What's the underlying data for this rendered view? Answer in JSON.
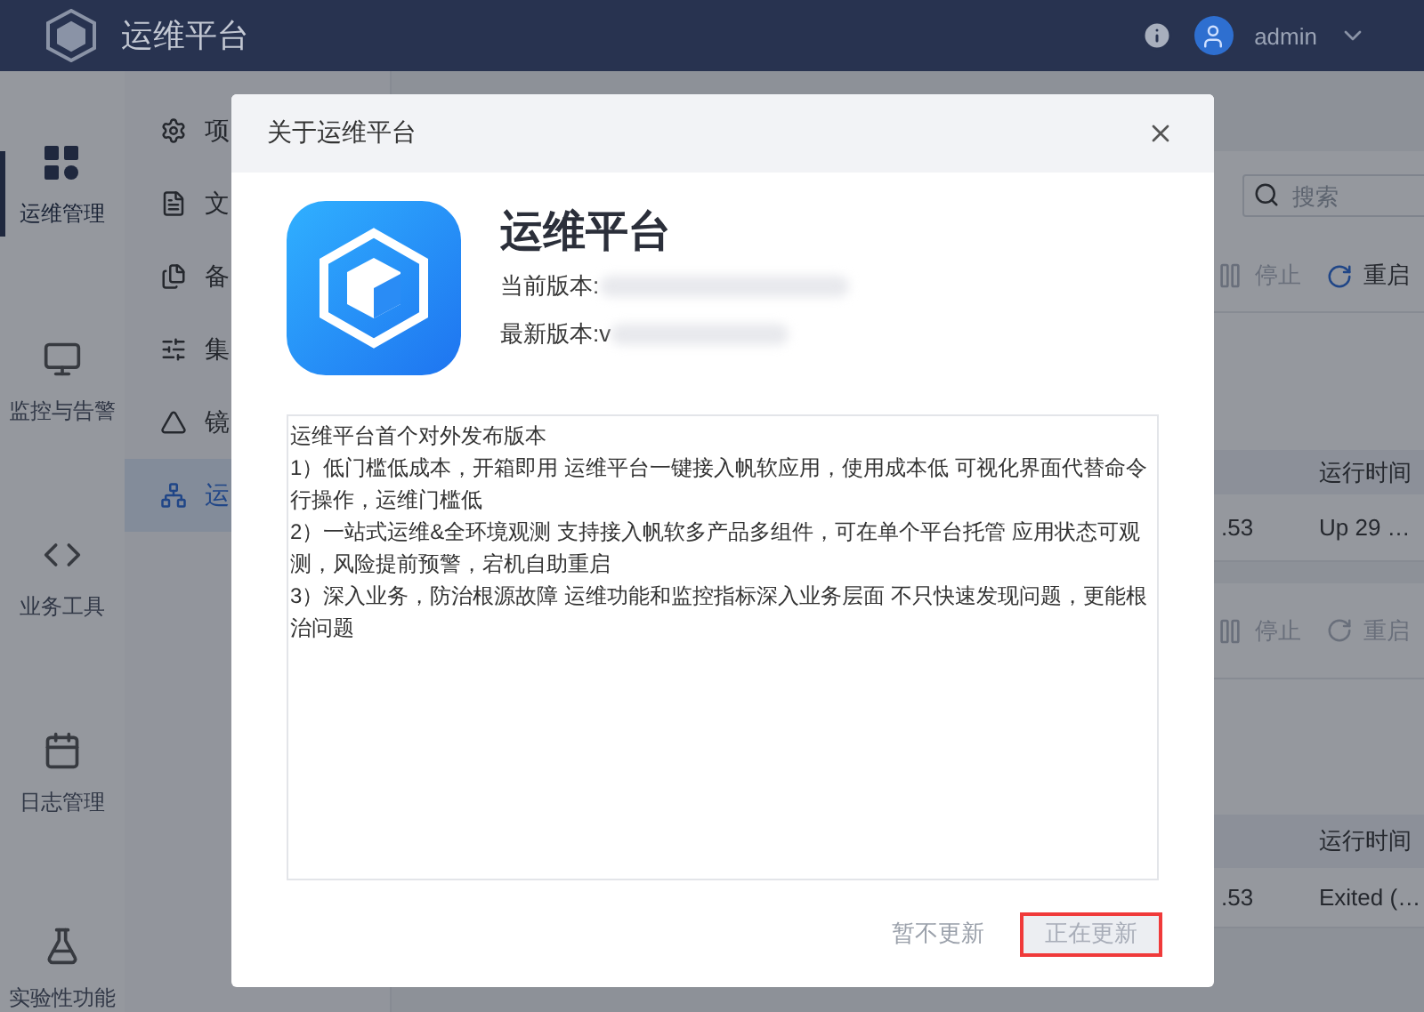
{
  "top_bar": {
    "title": "运维平台",
    "user": "admin"
  },
  "nav_rail": [
    {
      "label": "运维管理",
      "selected": true
    },
    {
      "label": "监控与告警",
      "selected": false
    },
    {
      "label": "业务工具",
      "selected": false
    },
    {
      "label": "日志管理",
      "selected": false
    },
    {
      "label": "实验性功能",
      "selected": false
    }
  ],
  "sub_menu": [
    {
      "label": "项",
      "selected": false
    },
    {
      "label": "文",
      "selected": false
    },
    {
      "label": "备",
      "selected": false
    },
    {
      "label": "集",
      "selected": false
    },
    {
      "label": "镜",
      "selected": false
    },
    {
      "label": "运",
      "selected": true
    }
  ],
  "search": {
    "placeholder": "搜索"
  },
  "panels": [
    {
      "actions": [
        {
          "label": "停止",
          "disabled": true
        },
        {
          "label": "重启",
          "disabled": false
        }
      ],
      "column_header": "运行时间",
      "row": {
        "column_2": ".53",
        "column_3": "Up 29 …"
      }
    },
    {
      "actions": [
        {
          "label": "停止",
          "disabled": true
        },
        {
          "label": "重启",
          "disabled": true
        }
      ],
      "column_header": "运行时间",
      "row": {
        "column_2": ".53",
        "column_3": "Exited (…"
      }
    }
  ],
  "dialog": {
    "title": "关于运维平台",
    "app_name": "运维平台",
    "current_version_label": "当前版本:",
    "latest_version_label": "最新版本:v",
    "release_notes": "运维平台首个对外发布版本\n1）低门槛低成本，开箱即用 运维平台一键接入帆软应用，使用成本低 可视化界面代替命令行操作，运维门槛低\n2）一站式运维&全环境观测 支持接入帆软多产品多组件，可在单个平台托管 应用状态可观测，风险提前预警，宕机自助重启\n3）深入业务，防治根源故障 运维功能和监控指标深入业务层面 不只快速发现问题，更能根治问题",
    "buttons": [
      {
        "label": "暂不更新",
        "kind": "text",
        "disabled": false,
        "highlighted": false
      },
      {
        "label": "正在更新",
        "kind": "filled",
        "disabled": true,
        "highlighted": true
      }
    ]
  }
}
